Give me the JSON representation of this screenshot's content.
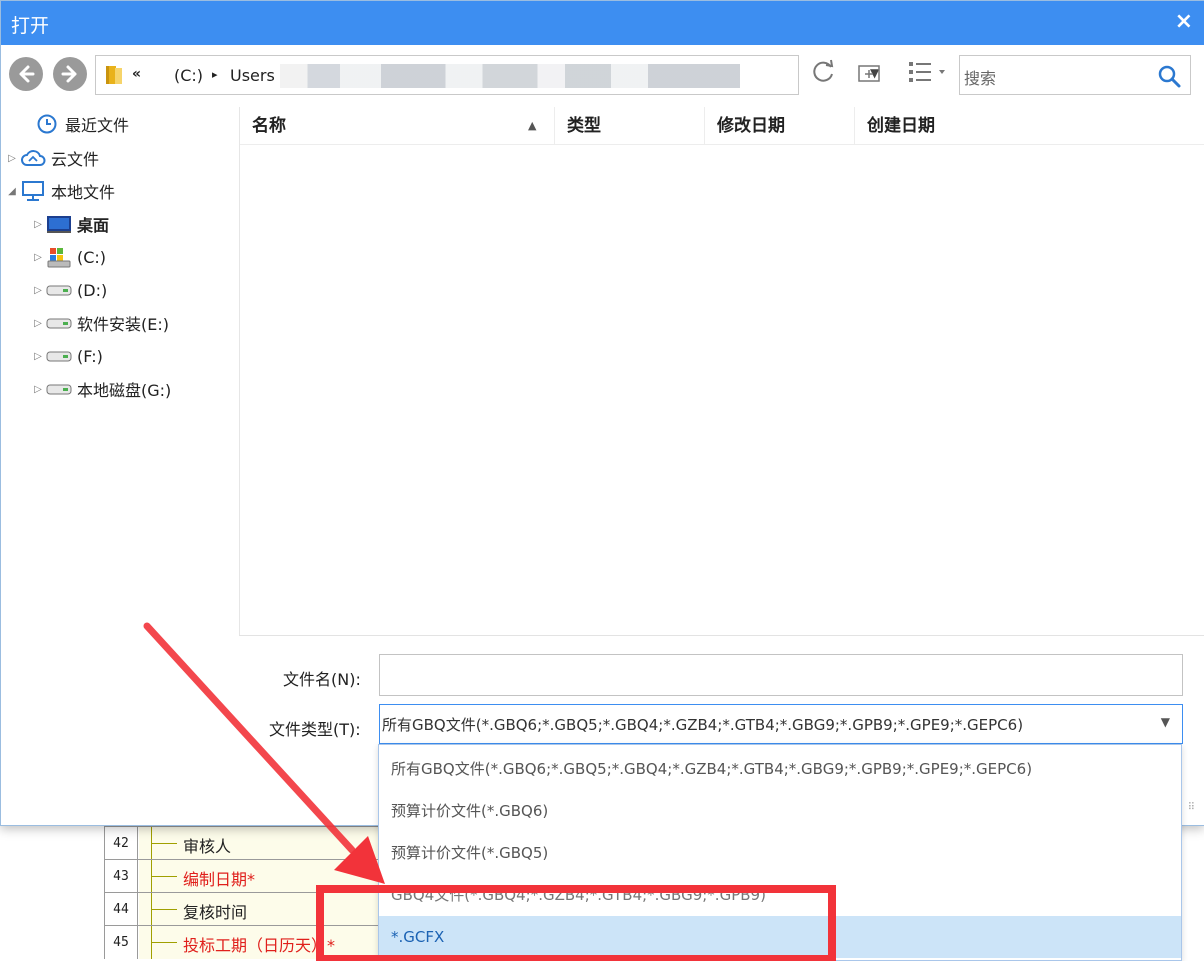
{
  "window": {
    "title": "打开",
    "close_glyph": "×"
  },
  "address": {
    "chevron": "«",
    "segments": [
      "(C:)",
      "Users"
    ],
    "separator": "▸",
    "dropdown_glyph": "▼"
  },
  "search": {
    "placeholder": "搜索"
  },
  "sidebar": {
    "items": [
      {
        "label": "最近文件",
        "icon": "clock-icon",
        "arrow": ""
      },
      {
        "label": "云文件",
        "icon": "cloud-icon",
        "arrow": "▷"
      },
      {
        "label": "本地文件",
        "icon": "monitor-icon",
        "arrow": "◢"
      },
      {
        "label": "桌面",
        "icon": "desktop-icon",
        "arrow": "▷"
      },
      {
        "label": "(C:)",
        "icon": "system-drive-icon",
        "arrow": "▷"
      },
      {
        "label": "(D:)",
        "icon": "drive-icon",
        "arrow": "▷"
      },
      {
        "label": "软件安装(E:)",
        "icon": "drive-icon",
        "arrow": "▷"
      },
      {
        "label": "(F:)",
        "icon": "drive-icon",
        "arrow": "▷"
      },
      {
        "label": "本地磁盘(G:)",
        "icon": "drive-icon",
        "arrow": "▷"
      }
    ]
  },
  "filelist": {
    "columns": [
      "名称",
      "类型",
      "修改日期",
      "创建日期"
    ],
    "sort_glyph": "▲"
  },
  "form": {
    "filename_label": "文件名(N):",
    "filename_value": "",
    "filetype_label": "文件类型(T):",
    "filetype_value": "所有GBQ文件(*.GBQ6;*.GBQ5;*.GBQ4;*.GZB4;*.GTB4;*.GBG9;*.GPB9;*.GPE9;*.GEPC6)",
    "filetype_arrow": "▼",
    "grip_glyph": "⠿"
  },
  "dropdown": {
    "options": [
      "所有GBQ文件(*.GBQ6;*.GBQ5;*.GBQ4;*.GZB4;*.GTB4;*.GBG9;*.GPB9;*.GPE9;*.GEPC6)",
      "预算计价文件(*.GBQ6)",
      "预算计价文件(*.GBQ5)",
      "GBQ4文件(*.GBQ4;*.GZB4;*.GTB4;*.GBG9;*.GPB9)",
      "*.GCFX"
    ],
    "selected_index": 4
  },
  "background_sheet": {
    "rows": [
      {
        "num": "42",
        "text": "审核人",
        "red": false
      },
      {
        "num": "43",
        "text": "编制日期*",
        "red": true
      },
      {
        "num": "44",
        "text": "复核时间",
        "red": false
      },
      {
        "num": "45",
        "text": "投标工期（日历天）*",
        "red": true
      }
    ]
  },
  "colors": {
    "titlebar": "#3d8ef1",
    "annotation": "#f2333a",
    "selected_option_bg": "#cce4f8",
    "required_text": "#e0201c"
  }
}
